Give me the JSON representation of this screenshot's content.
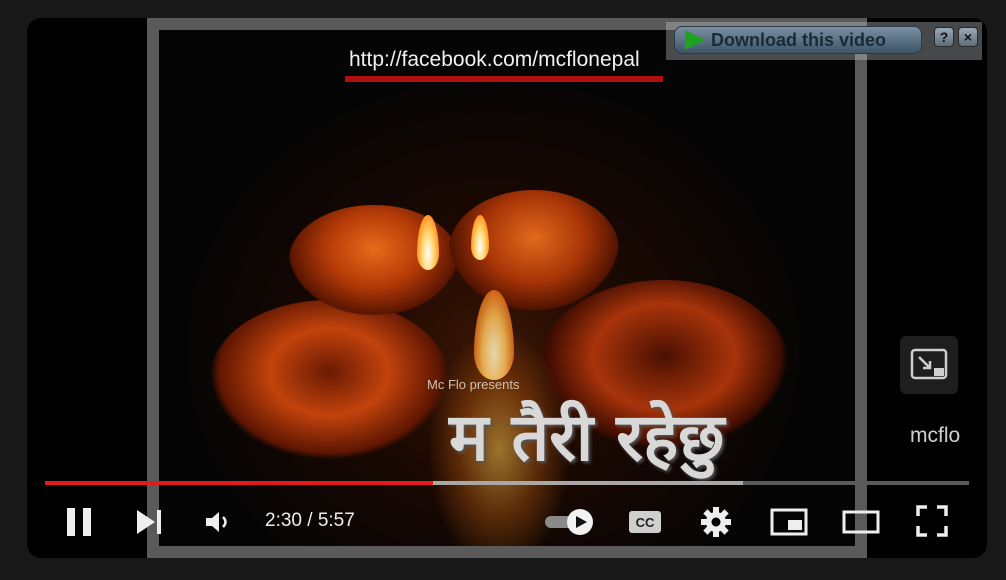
{
  "video": {
    "overlay_url": "http://facebook.com/mcflonepal",
    "presents_text": "Mc Flo presents",
    "title_devanagari": "म तैरी रहेछु"
  },
  "download_bar": {
    "label": "Download this video",
    "help_label": "?",
    "close_label": "×"
  },
  "channel": {
    "name": "mcflo"
  },
  "controls": {
    "current_time": "2:30",
    "separator": "/",
    "duration": "5:57",
    "played_fraction": 0.42,
    "loaded_fraction": 0.755,
    "autoplay_on": true,
    "icons": [
      "pause-icon",
      "next-icon",
      "volume-icon",
      "autoplay-toggle",
      "captions-icon",
      "settings-icon",
      "miniplayer-icon",
      "theater-icon",
      "fullscreen-icon"
    ]
  },
  "colors": {
    "progress": "#e11b1b",
    "background": "#181818",
    "download_green": "#1fa31f"
  }
}
